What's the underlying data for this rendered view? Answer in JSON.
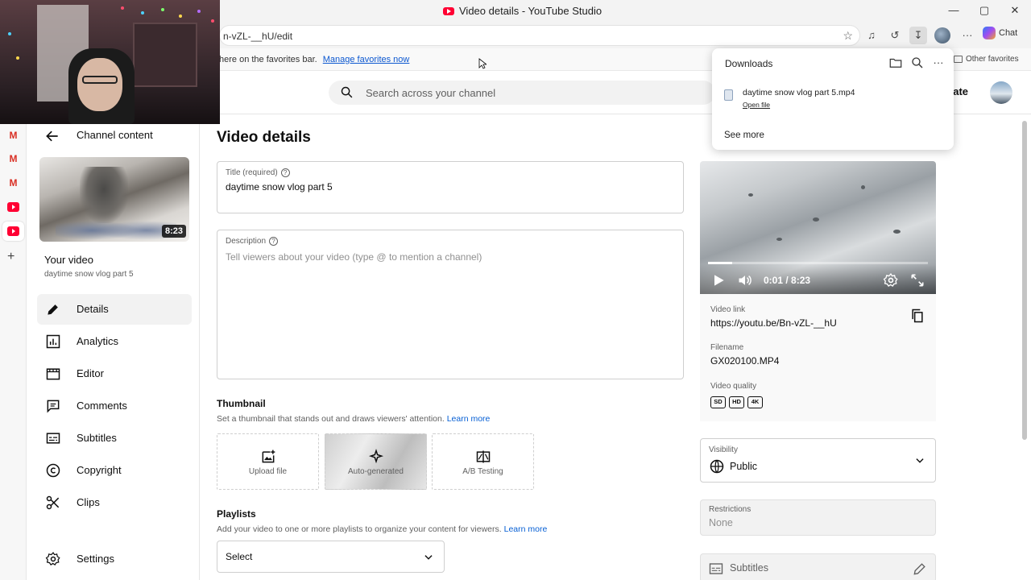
{
  "browser": {
    "window_title": "Video details - YouTube Studio",
    "url": "n-vZL-__hU/edit",
    "favorites_bar_text": "here on the favorites bar.",
    "manage_favorites_link": "Manage favorites now",
    "other_favorites": "Other favorites",
    "chat_label": "Chat"
  },
  "downloads": {
    "title": "Downloads",
    "file_name": "daytime snow vlog part 5.mp4",
    "open_file": "Open file",
    "see_more": "See more"
  },
  "header": {
    "search_placeholder": "Search across your channel",
    "create_label_fragment": "eate"
  },
  "sidebar": {
    "back_label": "Channel content",
    "thumbnail_duration": "8:23",
    "your_video_heading": "Your video",
    "video_title": "daytime snow vlog part 5",
    "items": [
      {
        "label": "Details",
        "icon": "pencil-icon",
        "active": true
      },
      {
        "label": "Analytics",
        "icon": "analytics-icon",
        "active": false
      },
      {
        "label": "Editor",
        "icon": "editor-icon",
        "active": false
      },
      {
        "label": "Comments",
        "icon": "comments-icon",
        "active": false
      },
      {
        "label": "Subtitles",
        "icon": "subtitles-icon",
        "active": false
      },
      {
        "label": "Copyright",
        "icon": "copyright-icon",
        "active": false
      },
      {
        "label": "Clips",
        "icon": "scissors-icon",
        "active": false
      }
    ],
    "settings_label": "Settings"
  },
  "main": {
    "page_title": "Video details",
    "title_field": {
      "label": "Title (required)",
      "value": "daytime snow vlog part 5"
    },
    "description_field": {
      "label": "Description",
      "placeholder": "Tell viewers about your video (type @ to mention a channel)"
    },
    "thumbnail": {
      "heading": "Thumbnail",
      "subtitle": "Set a thumbnail that stands out and draws viewers' attention.",
      "learn_more": "Learn more",
      "options": [
        "Upload file",
        "Auto-generated",
        "A/B Testing"
      ]
    },
    "playlists": {
      "heading": "Playlists",
      "subtitle": "Add your video to one or more playlists to organize your content for viewers.",
      "learn_more": "Learn more",
      "select_label": "Select"
    }
  },
  "player": {
    "time": "0:01 / 8:23",
    "progress_fraction": 0.11
  },
  "video_info": {
    "link_label": "Video link",
    "link_url": "https://youtu.be/Bn-vZL-__hU",
    "filename_label": "Filename",
    "filename": "GX020100.MP4",
    "quality_label": "Video quality",
    "quality_badges": [
      "SD",
      "HD",
      "4K"
    ]
  },
  "visibility": {
    "label": "Visibility",
    "value": "Public"
  },
  "restrictions": {
    "label": "Restrictions",
    "value": "None"
  },
  "subtitles_box": {
    "label": "Subtitles"
  },
  "colors": {
    "link": "#065fd4",
    "youtube_red": "#ff0033",
    "gmail_red": "#d93025"
  }
}
